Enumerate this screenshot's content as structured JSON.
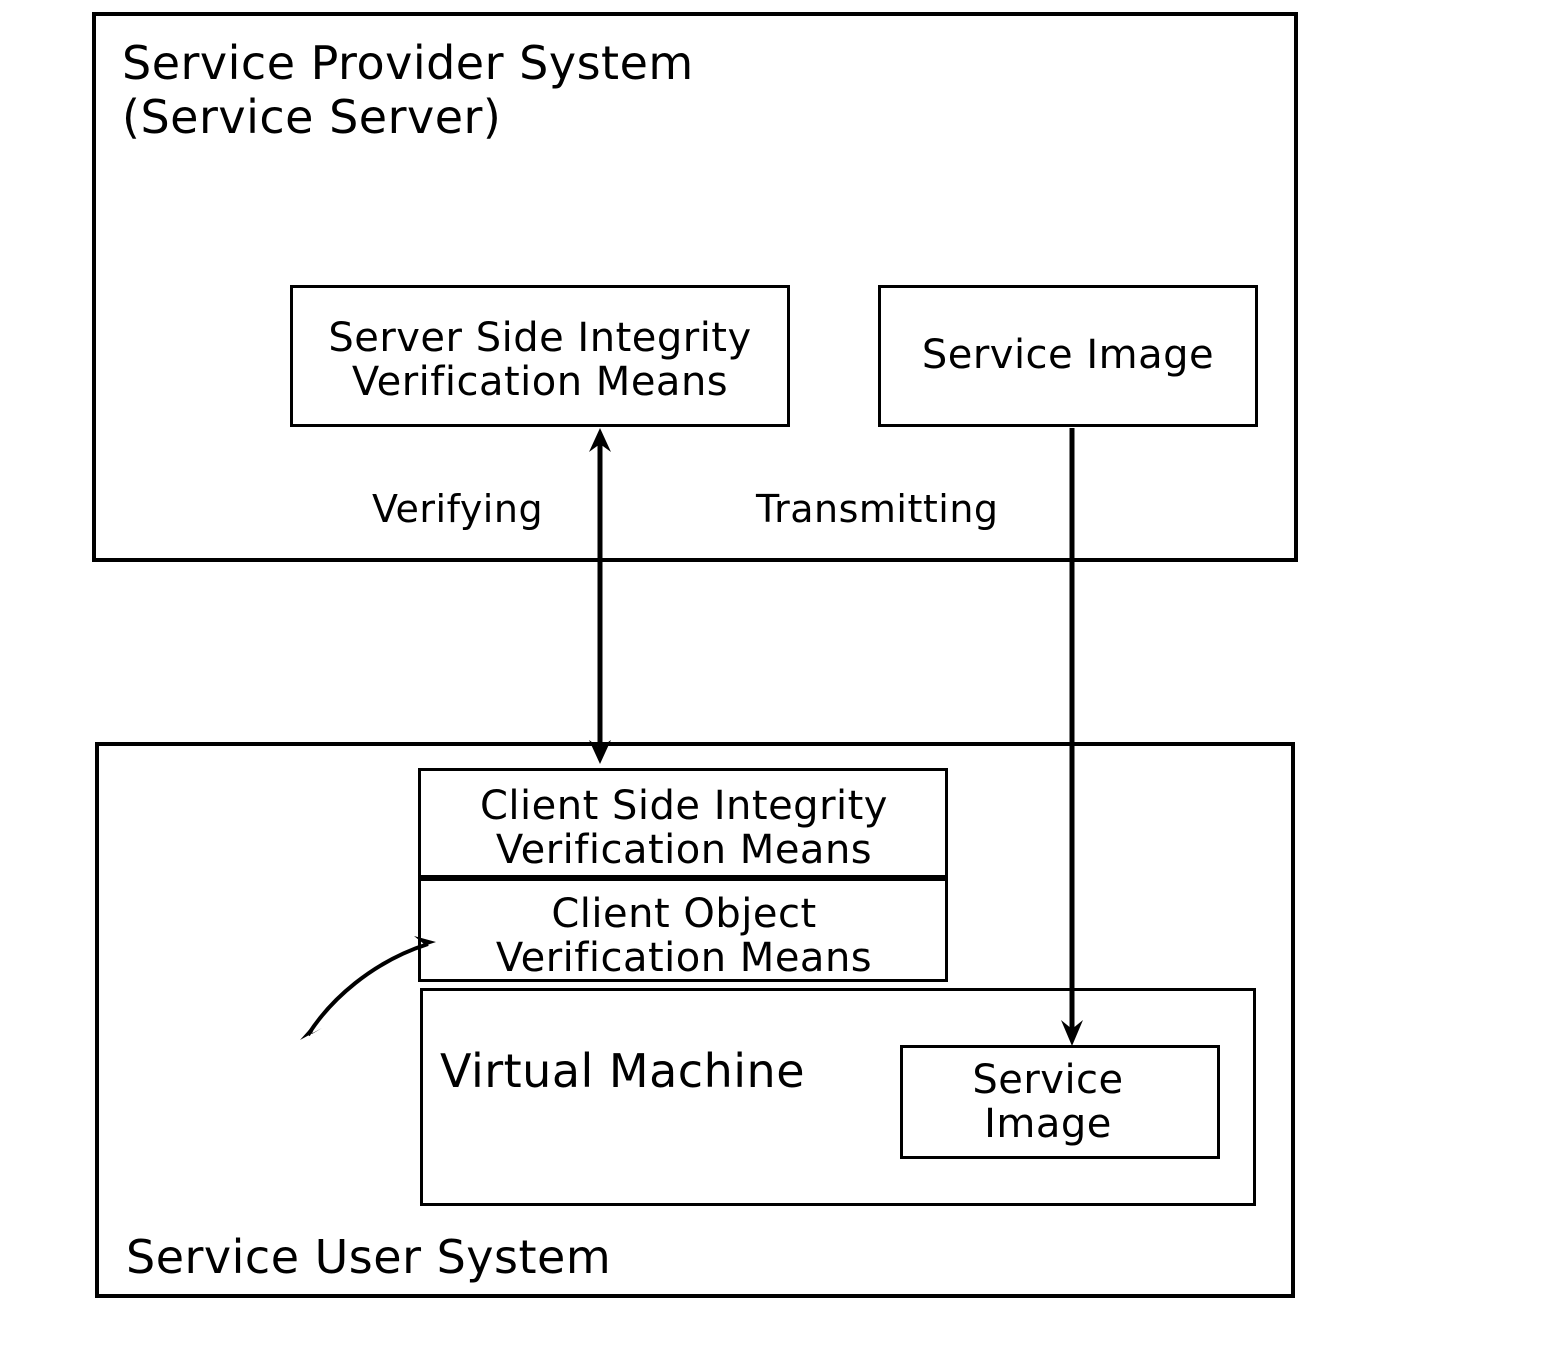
{
  "diagram": {
    "title": "Service Provider System / Service User System integrity verification diagram",
    "provider": {
      "label_line1": "Service Provider System",
      "label_line2": "(Service Server)",
      "server_integrity_box": {
        "line1": "Server Side Integrity",
        "line2": "Verification Means"
      },
      "service_image_box": {
        "line1": "Service Image"
      }
    },
    "connections": {
      "verifying_label": "Verifying",
      "transmitting_label": "Transmitting"
    },
    "user": {
      "label": "Service User System",
      "client_integrity_box": {
        "line1": "Client Side Integrity",
        "line2": "Verification Means"
      },
      "client_object_box": {
        "line1": "Client Object",
        "line2": "Verification Means"
      },
      "virtual_machine_box": {
        "label": "Virtual Machine"
      },
      "service_image_box": {
        "line1": "Service",
        "line2": "Image"
      }
    },
    "colors": {
      "stroke": "#000000",
      "background": "#ffffff"
    }
  }
}
